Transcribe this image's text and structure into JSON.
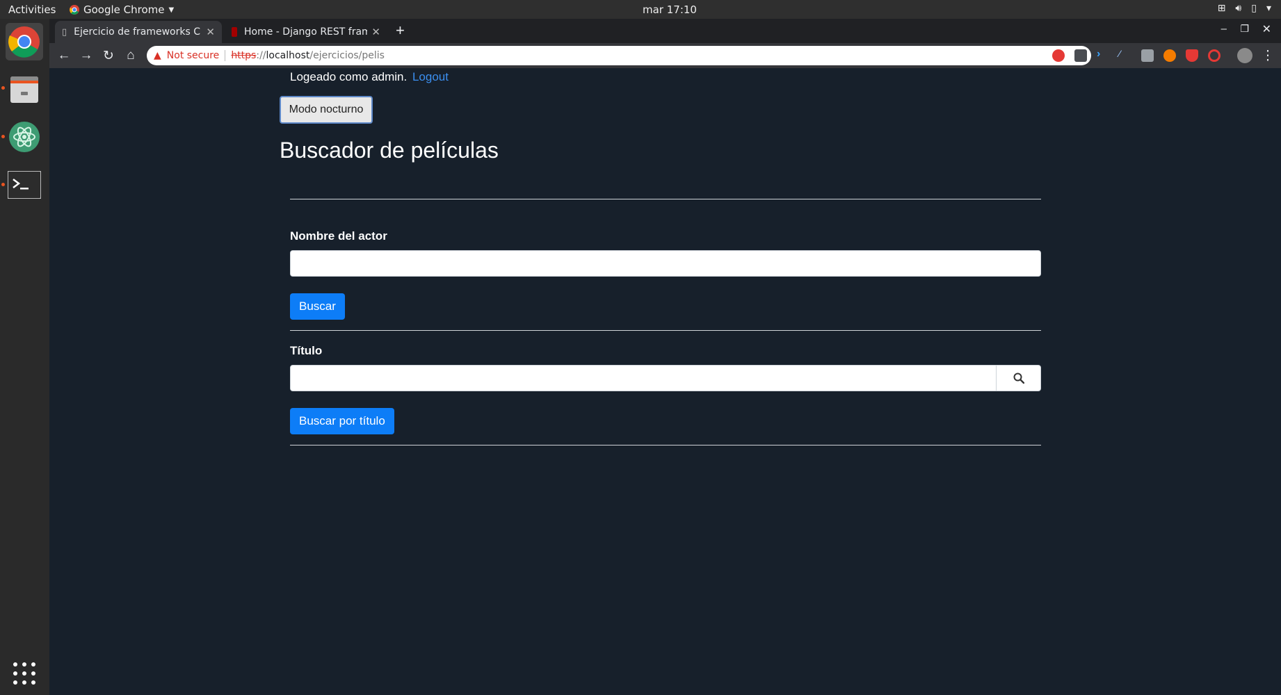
{
  "os": {
    "activities": "Activities",
    "app_name": "Google Chrome",
    "clock": "mar 17:10"
  },
  "browser": {
    "tabs": [
      {
        "title": "Ejercicio de frameworks C"
      },
      {
        "title": "Home - Django REST fram"
      }
    ],
    "url_warning": "Not secure",
    "url_scheme": "https",
    "url_sep": "://",
    "url_host": "localhost",
    "url_path": "/ejercicios/pelis"
  },
  "page": {
    "login_text": "Logeado como admin.",
    "logout_link": "Logout",
    "night_mode_button": "Modo nocturno",
    "heading": "Buscador de películas",
    "actor_label": "Nombre del actor",
    "actor_value": "",
    "search_button": "Buscar",
    "title_label": "Título",
    "title_value": "",
    "search_title_button": "Buscar por título"
  },
  "colors": {
    "page_bg": "#17202b",
    "primary": "#0d7df7",
    "link": "#3b8ff0"
  },
  "icons": [
    "chrome-icon",
    "files-icon",
    "atom-icon",
    "terminal-icon",
    "apps-grid-icon",
    "search-icon",
    "star-icon"
  ]
}
